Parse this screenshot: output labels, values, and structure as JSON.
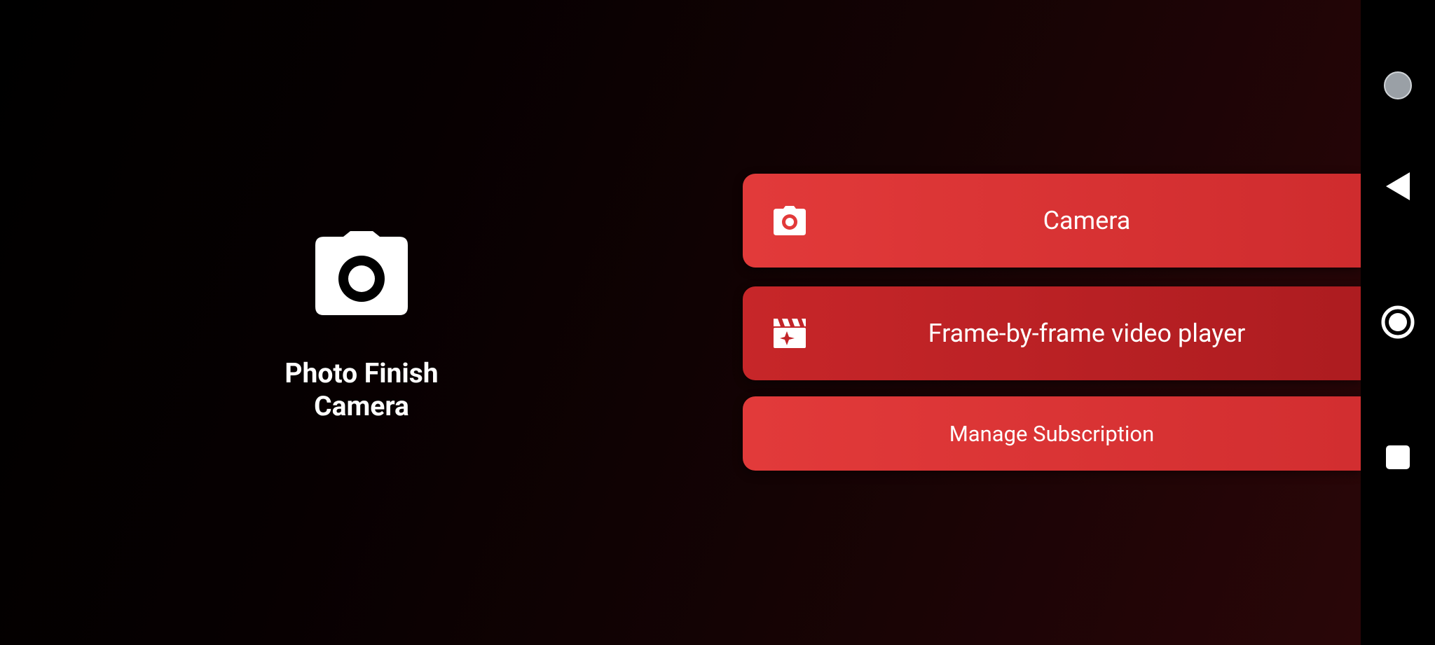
{
  "app": {
    "title": "Photo Finish\nCamera",
    "logo_icon": "camera-icon"
  },
  "menu": {
    "camera_label": "Camera",
    "camera_icon": "camera-icon",
    "player_label": "Frame-by-frame video player",
    "player_icon": "clapperboard-icon",
    "manage_label": "Manage Subscription"
  },
  "navbar": {
    "items": [
      "assistant-dot-icon",
      "back-icon",
      "home-icon",
      "recents-icon"
    ]
  },
  "colors": {
    "accent": "#e23a3a",
    "accent_dark": "#b11e22",
    "background": "#000000",
    "text": "#ffffff"
  }
}
